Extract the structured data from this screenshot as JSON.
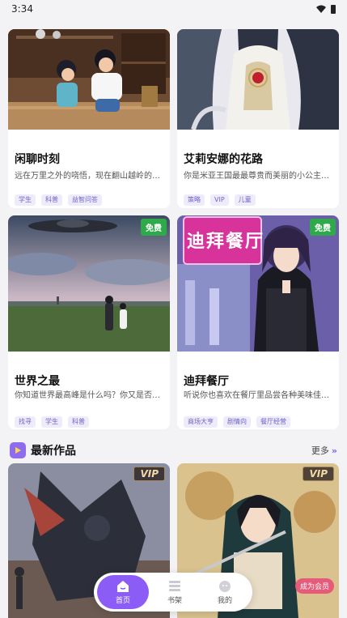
{
  "status": {
    "time": "3:34"
  },
  "cards": [
    {
      "title": "闲聊时刻",
      "desc": "远在万里之外的哓悟，现在翻山越岭的来找...",
      "tags": [
        "学生",
        "科普",
        "益智问答"
      ]
    },
    {
      "title": "艾莉安娜的花路",
      "desc": "你是米亚王国最最尊贵而美丽的小公主，你...",
      "tags": [
        "策略",
        "VIP",
        "儿童"
      ]
    },
    {
      "title": "世界之最",
      "desc": "你知道世界最高峰是什么吗？你又是否知道...",
      "tags": [
        "找寻",
        "学生",
        "科普"
      ],
      "badge": "免费"
    },
    {
      "title": "迪拜餐厅",
      "desc": "听说你也喜欢在餐厅里品尝各种美味佳肴？...",
      "tags": [
        "商场大亨",
        "剧情向",
        "餐厅经营"
      ],
      "badge": "免费",
      "sign_text": "迪拜餐厅"
    }
  ],
  "section": {
    "title": "最新作品",
    "more_label": "更多",
    "more_arrow": "»"
  },
  "latest": [
    {
      "badge": "VIP"
    },
    {
      "badge": "VIP",
      "member_badge": "成为会员"
    }
  ],
  "nav": [
    {
      "label": "首页",
      "icon": "home-icon",
      "active": true
    },
    {
      "label": "书架",
      "icon": "bookshelf-icon",
      "active": false
    },
    {
      "label": "我的",
      "icon": "profile-icon",
      "active": false
    }
  ],
  "colors": {
    "accent": "#8b5cf6",
    "free_badge": "#2faa4a",
    "tag_text": "#6f63c8"
  }
}
